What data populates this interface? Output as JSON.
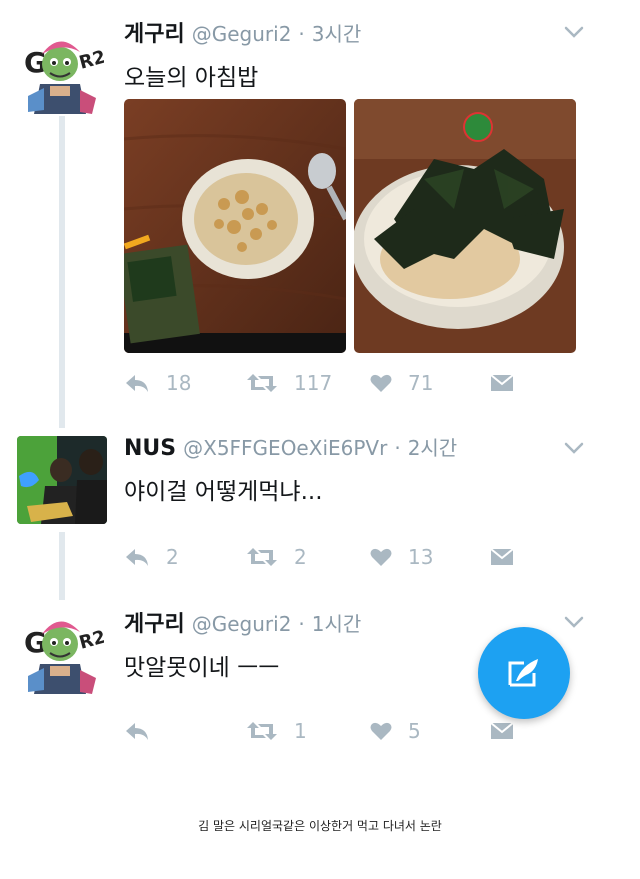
{
  "tweets": [
    {
      "name": "게구리",
      "handle": "@Geguri2",
      "time": "3시간",
      "text": "오늘의 아침밥",
      "avatar_icon": "geguri-avatar-icon",
      "reply_count": "18",
      "retweet_count": "117",
      "like_count": "71"
    },
    {
      "name": "NUS",
      "handle": "@X5FFGEOeXiE6PVr",
      "time": "2시간",
      "text": "야이걸 어떻게먹냐...",
      "avatar_icon": "nus-avatar-icon",
      "reply_count": "2",
      "retweet_count": "2",
      "like_count": "13"
    },
    {
      "name": "게구리",
      "handle": "@Geguri2",
      "time": "1시간",
      "text": "맛알못이네 ㅡㅡ",
      "avatar_icon": "geguri-avatar-icon",
      "reply_count": "",
      "retweet_count": "1",
      "like_count": "5"
    }
  ],
  "separator": "·",
  "caption": "김 말은 시리얼국같은 이상한거 먹고 다녀서 논란",
  "colors": {
    "accent": "#1da1f2",
    "muted": "#aab8c2",
    "thread_line": "#e1e8ed"
  }
}
